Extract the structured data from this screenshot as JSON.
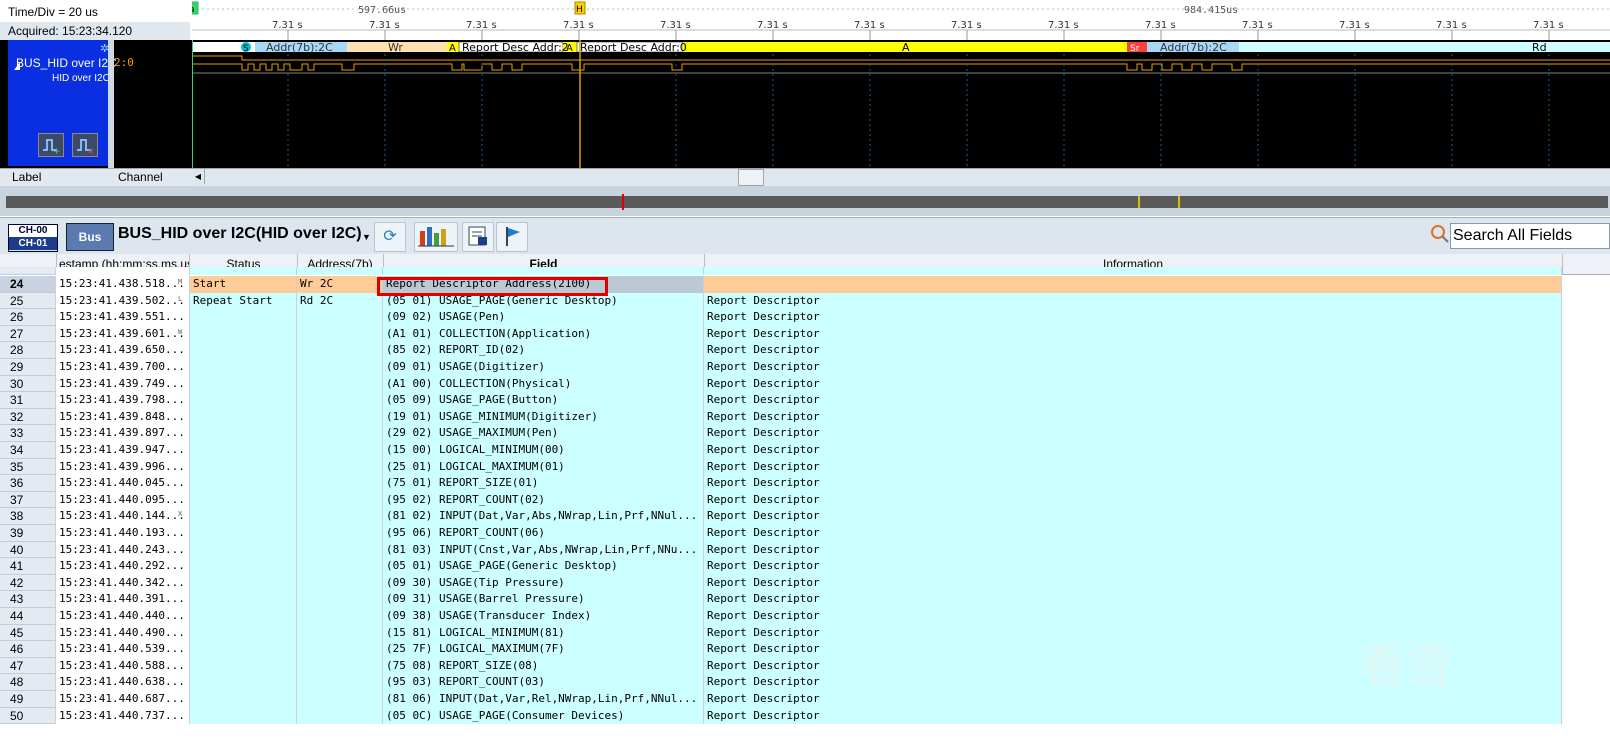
{
  "analyzer": {
    "time_div": "Time/Div = 20 us",
    "acquired": "Acquired: 15:23:34.120",
    "channel_name": "BUS_HID over I2C",
    "channel_sub": "HID over I2C",
    "channel_value": "2:0",
    "label_col": "Label",
    "channel_col": "Channel"
  },
  "ruler": {
    "cursor_a": "597.66us",
    "cursor_b": "984.415us",
    "tick_label": "7.31 s",
    "tick_count": 14
  },
  "decode_labels": {
    "s1": "S",
    "addr1": "Addr(7b):2C",
    "wr": "Wr",
    "a1": "A",
    "rda2": "Report Desc Addr:2",
    "a2": "A",
    "rda0": "Report Desc Addr:0",
    "a_big": "A",
    "sr": "Sr",
    "addr2": "Addr(7b):2C",
    "rd": "Rd"
  },
  "toolbar": {
    "ch_top": "CH-00",
    "ch_bottom": "CH-01",
    "bus_label": "Bus",
    "title": "BUS_HID over I2C(HID over I2C)",
    "search_placeholder": "Search All Fields"
  },
  "table": {
    "headers": {
      "timestamp": "estamp (hh:mm:ss.ms.us",
      "status": "Status",
      "address": "Address(7b)",
      "field": "Field",
      "info": "Information"
    },
    "rows": [
      {
        "num": "24",
        "ts": "15:23:41.438.518...",
        "status": "Start",
        "addr": "Wr 2C",
        "field": "Report Descriptor Address(2100)",
        "info": "",
        "mark": "M"
      },
      {
        "num": "25",
        "ts": "15:23:41.439.502...",
        "status": "Repeat Start",
        "addr": "Rd 2C",
        "field": "(05 01)  USAGE_PAGE(Generic Desktop)",
        "info": "Report Descriptor",
        "mark": "L"
      },
      {
        "num": "26",
        "ts": "15:23:41.439.551...",
        "status": "",
        "addr": "",
        "field": "(09 02)  USAGE(Pen)",
        "info": "Report Descriptor",
        "mark": ""
      },
      {
        "num": "27",
        "ts": "15:23:41.439.601...",
        "status": "",
        "addr": "",
        "field": "(A1 01)  COLLECTION(Application)",
        "info": "Report Descriptor",
        "mark": "W"
      },
      {
        "num": "28",
        "ts": "15:23:41.439.650...",
        "status": "",
        "addr": "",
        "field": "(85 02)  REPORT_ID(02)",
        "info": "Report Descriptor",
        "mark": ""
      },
      {
        "num": "29",
        "ts": "15:23:41.439.700...",
        "status": "",
        "addr": "",
        "field": "(09 01)  USAGE(Digitizer)",
        "info": "Report Descriptor",
        "mark": ""
      },
      {
        "num": "30",
        "ts": "15:23:41.439.749...",
        "status": "",
        "addr": "",
        "field": "(A1 00)  COLLECTION(Physical)",
        "info": "Report Descriptor",
        "mark": ""
      },
      {
        "num": "31",
        "ts": "15:23:41.439.798...",
        "status": "",
        "addr": "",
        "field": "(05 09)  USAGE_PAGE(Button)",
        "info": "Report Descriptor",
        "mark": ""
      },
      {
        "num": "32",
        "ts": "15:23:41.439.848...",
        "status": "",
        "addr": "",
        "field": "(19 01)  USAGE_MINIMUM(Digitizer)",
        "info": "Report Descriptor",
        "mark": ""
      },
      {
        "num": "33",
        "ts": "15:23:41.439.897...",
        "status": "",
        "addr": "",
        "field": "(29 02)  USAGE_MAXIMUM(Pen)",
        "info": "Report Descriptor",
        "mark": ""
      },
      {
        "num": "34",
        "ts": "15:23:41.439.947...",
        "status": "",
        "addr": "",
        "field": "(15 00)  LOGICAL_MINIMUM(00)",
        "info": "Report Descriptor",
        "mark": ""
      },
      {
        "num": "35",
        "ts": "15:23:41.439.996...",
        "status": "",
        "addr": "",
        "field": "(25 01)  LOGICAL_MAXIMUM(01)",
        "info": "Report Descriptor",
        "mark": ""
      },
      {
        "num": "36",
        "ts": "15:23:41.440.045...",
        "status": "",
        "addr": "",
        "field": "(75 01)  REPORT_SIZE(01)",
        "info": "Report Descriptor",
        "mark": ""
      },
      {
        "num": "37",
        "ts": "15:23:41.440.095...",
        "status": "",
        "addr": "",
        "field": "(95 02)  REPORT_COUNT(02)",
        "info": "Report Descriptor",
        "mark": ""
      },
      {
        "num": "38",
        "ts": "15:23:41.440.144...",
        "status": "",
        "addr": "",
        "field": "(81 02)  INPUT(Dat,Var,Abs,NWrap,Lin,Prf,NNul...",
        "info": "Report Descriptor",
        "mark": "X"
      },
      {
        "num": "39",
        "ts": "15:23:41.440.193...",
        "status": "",
        "addr": "",
        "field": "(95 06)  REPORT_COUNT(06)",
        "info": "Report Descriptor",
        "mark": ""
      },
      {
        "num": "40",
        "ts": "15:23:41.440.243...",
        "status": "",
        "addr": "",
        "field": "(81 03)  INPUT(Cnst,Var,Abs,NWrap,Lin,Prf,NNu...",
        "info": "Report Descriptor",
        "mark": ""
      },
      {
        "num": "41",
        "ts": "15:23:41.440.292...",
        "status": "",
        "addr": "",
        "field": "(05 01)  USAGE_PAGE(Generic Desktop)",
        "info": "Report Descriptor",
        "mark": ""
      },
      {
        "num": "42",
        "ts": "15:23:41.440.342...",
        "status": "",
        "addr": "",
        "field": "(09 30)  USAGE(Tip Pressure)",
        "info": "Report Descriptor",
        "mark": ""
      },
      {
        "num": "43",
        "ts": "15:23:41.440.391...",
        "status": "",
        "addr": "",
        "field": "(09 31)  USAGE(Barrel Pressure)",
        "info": "Report Descriptor",
        "mark": ""
      },
      {
        "num": "44",
        "ts": "15:23:41.440.440...",
        "status": "",
        "addr": "",
        "field": "(09 38)  USAGE(Transducer Index)",
        "info": "Report Descriptor",
        "mark": ""
      },
      {
        "num": "45",
        "ts": "15:23:41.440.490...",
        "status": "",
        "addr": "",
        "field": "(15 81)  LOGICAL_MINIMUM(81)",
        "info": "Report Descriptor",
        "mark": ""
      },
      {
        "num": "46",
        "ts": "15:23:41.440.539...",
        "status": "",
        "addr": "",
        "field": "(25 7F)  LOGICAL_MAXIMUM(7F)",
        "info": "Report Descriptor",
        "mark": ""
      },
      {
        "num": "47",
        "ts": "15:23:41.440.588...",
        "status": "",
        "addr": "",
        "field": "(75 08)  REPORT_SIZE(08)",
        "info": "Report Descriptor",
        "mark": ""
      },
      {
        "num": "48",
        "ts": "15:23:41.440.638...",
        "status": "",
        "addr": "",
        "field": "(95 03)  REPORT_COUNT(03)",
        "info": "Report Descriptor",
        "mark": ""
      },
      {
        "num": "49",
        "ts": "15:23:41.440.687...",
        "status": "",
        "addr": "",
        "field": "(81 06)  INPUT(Dat,Var,Rel,NWrap,Lin,Prf,NNul...",
        "info": "Report Descriptor",
        "mark": ""
      },
      {
        "num": "50",
        "ts": "15:23:41.440.737...",
        "status": "",
        "addr": "",
        "field": "(05 0C)  USAGE_PAGE(Consumer Devices)",
        "info": "Report Descriptor",
        "mark": ""
      }
    ],
    "selected_row": "24"
  },
  "watermark": "看雪",
  "colors": {
    "row_bg": "#ccffff",
    "selected_bg": "#ffcc99",
    "decode_yellow": "#ffff00",
    "decode_blue": "#a8d8f8",
    "wave_orange": "#e8a000",
    "cursor_gold": "#d4a000",
    "cursor_green": "#3cd070",
    "highlight_red": "#e00000"
  }
}
